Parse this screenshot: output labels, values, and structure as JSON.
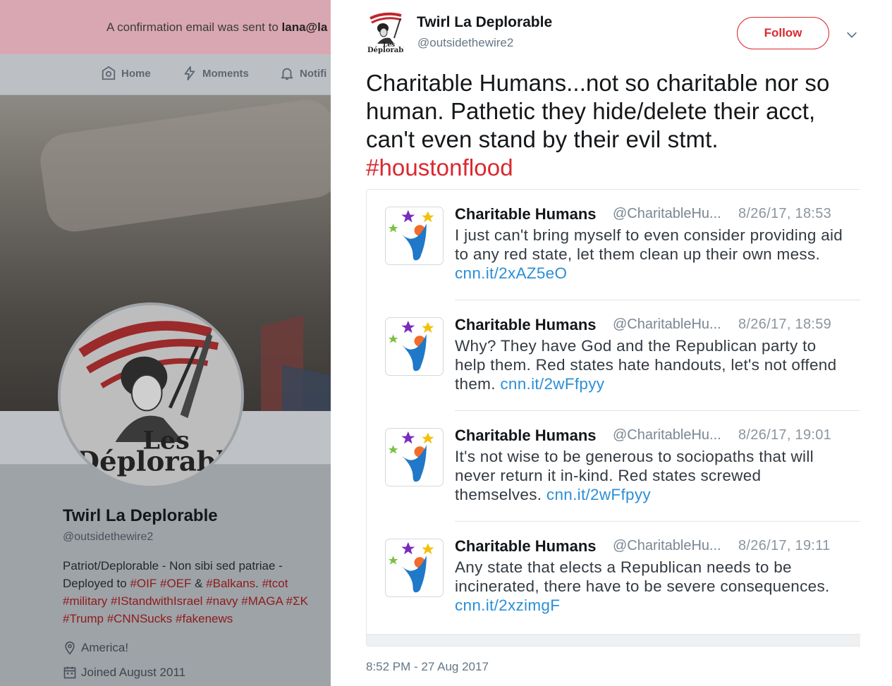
{
  "background_page": {
    "confirmation": {
      "prefix": "A confirmation email was sent to ",
      "email": "lana@la"
    },
    "nav": {
      "home": "Home",
      "moments": "Moments",
      "notifications": "Notifi"
    },
    "profile": {
      "name": "Twirl La Deplorable",
      "handle": "@outsidethewire2",
      "bio": {
        "line1": "Patriot/Deplorable - Non sibi sed patriae -",
        "deployed_to": "Deployed to ",
        "oif": "#OIF",
        "oef": "#OEF",
        "amp": " & ",
        "balkans": "#Balkans",
        "dot": ". ",
        "tcot": "#tcot",
        "military": "#military",
        "istandwithisrael": "#IStandwithIsrael",
        "navy": "#navy",
        "maga": "#MAGA",
        "sk": "#ΣΚ",
        "trump": "#Trump",
        "cnnsucks": "#CNNSucks",
        "fakenews": "#fakenews"
      },
      "location": "America!",
      "joined": "Joined August 2011"
    },
    "colors": {
      "hashtag": "#8f1a1a"
    }
  },
  "tweet": {
    "author_name": "Twirl La Deplorable",
    "author_handle": "@outsidethewire2",
    "follow_label": "Follow",
    "text": "Charitable Humans...not so charitable nor so human. Pathetic they hide/delete their acct, can't even stand by their evil stmt.",
    "hashtag": "#houstonflood",
    "date": "8:52 PM - 27 Aug 2017",
    "accent_color": "#d9282f",
    "media": {
      "embedded_tweets": [
        {
          "name": "Charitable Humans",
          "handle": "@CharitableHu...",
          "time": "8/26/17, 18:53",
          "text": "I just can't bring myself to even consider providing aid to any red state, let them clean up their own mess.",
          "link": "cnn.it/2xAZ5eO"
        },
        {
          "name": "Charitable Humans",
          "handle": "@CharitableHu...",
          "time": "8/26/17, 18:59",
          "text": "Why? They have God and the Republican party to help them. Red states hate handouts, let's not offend them.",
          "link": "cnn.it/2wFfpyy"
        },
        {
          "name": "Charitable Humans",
          "handle": "@CharitableHu...",
          "time": "8/26/17, 19:01",
          "text": "It's not wise to be generous to sociopaths that will never return it in-kind. Red states screwed themselves.",
          "link": "cnn.it/2wFfpyy"
        },
        {
          "name": "Charitable Humans",
          "handle": "@CharitableHu...",
          "time": "8/26/17, 19:11",
          "text": "Any state that elects a Republican needs to be incinerated, there have to be severe consequences.",
          "link": "cnn.it/2xzimgF"
        }
      ],
      "link_color": "#2b8fd6"
    }
  },
  "icons": {
    "home": "home-icon",
    "moments": "lightning-icon",
    "notifications": "bell-icon",
    "location": "location-pin-icon",
    "calendar": "calendar-icon",
    "caret": "chevron-down-icon"
  },
  "logo_text": {
    "les": "Les",
    "deplorable": "Déplorable"
  }
}
